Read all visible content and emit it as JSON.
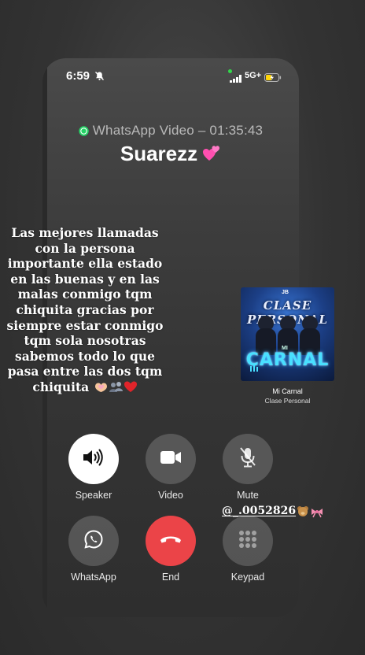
{
  "status_bar": {
    "time": "6:59",
    "network": "5G+"
  },
  "call": {
    "type_label": "WhatsApp Video – 01:35:43",
    "caller_name": "Suarezz"
  },
  "caption": {
    "text": "Las mejores llamadas con la persona importante ella estado en las buenas y en las malas conmigo tqm chiquita gracias por siempre estar conmigo tqm sola nosotras sabemos todo lo que pasa entre las dos tqm chiquita"
  },
  "music": {
    "song_title": "Mi Carnal",
    "artist": "Clase Personal",
    "album_art_text": "CLASE PERSONAL",
    "album_art_brand": "CARNAL",
    "album_art_small": "MI",
    "album_art_logo": "JB"
  },
  "controls": {
    "speaker": "Speaker",
    "video": "Video",
    "mute": "Mute",
    "whatsapp": "WhatsApp",
    "end": "End",
    "keypad": "Keypad"
  },
  "mention": {
    "handle": "@_.0052826"
  },
  "colors": {
    "end_red": "#eb4448",
    "whatsapp_green": "#25d366",
    "camera_dot": "#32d74b"
  }
}
